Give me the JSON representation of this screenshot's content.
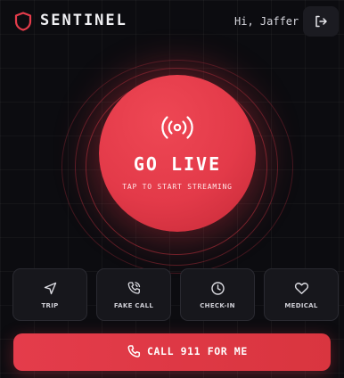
{
  "header": {
    "brand": "SENTINEL",
    "greeting": "Hi, Jaffer",
    "logo_icon": "shield-icon",
    "logout_icon": "logout-icon"
  },
  "live": {
    "title": "GO LIVE",
    "subtitle": "TAP TO START STREAMING",
    "icon": "broadcast-icon"
  },
  "actions": [
    {
      "label": "TRIP",
      "icon": "navigation-arrow-icon"
    },
    {
      "label": "FAKE CALL",
      "icon": "phone-call-icon"
    },
    {
      "label": "CHECK-IN",
      "icon": "clock-icon"
    },
    {
      "label": "MEDICAL",
      "icon": "heart-icon"
    }
  ],
  "call_button": {
    "label": "CALL 911 FOR ME",
    "icon": "phone-icon"
  },
  "colors": {
    "accent": "#e43c4b",
    "background": "#0c0c10",
    "card": "#17171c"
  }
}
